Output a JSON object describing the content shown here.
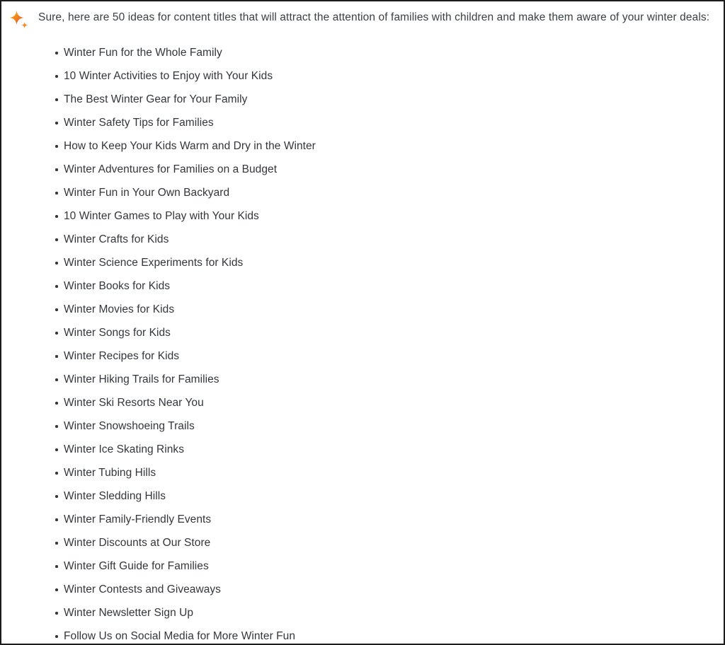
{
  "panel": {
    "border_color": "#1c1c1c",
    "background_color": "#ffffff",
    "text_color": "#33363b"
  },
  "icon": {
    "name": "sparkle-icon",
    "gradient_start": "#f9c22e",
    "gradient_mid": "#f07c1f",
    "gradient_end": "#e8452b"
  },
  "response": {
    "intro": "Sure, here are 50 ideas for content titles that will attract the attention of families with children and make them aware of your winter deals:",
    "items": [
      "Winter Fun for the Whole Family",
      "10 Winter Activities to Enjoy with Your Kids",
      "The Best Winter Gear for Your Family",
      "Winter Safety Tips for Families",
      "How to Keep Your Kids Warm and Dry in the Winter",
      "Winter Adventures for Families on a Budget",
      "Winter Fun in Your Own Backyard",
      "10 Winter Games to Play with Your Kids",
      "Winter Crafts for Kids",
      "Winter Science Experiments for Kids",
      "Winter Books for Kids",
      "Winter Movies for Kids",
      "Winter Songs for Kids",
      "Winter Recipes for Kids",
      "Winter Hiking Trails for Families",
      "Winter Ski Resorts Near You",
      "Winter Snowshoeing Trails",
      "Winter Ice Skating Rinks",
      "Winter Tubing Hills",
      "Winter Sledding Hills",
      "Winter Family-Friendly Events",
      "Winter Discounts at Our Store",
      "Winter Gift Guide for Families",
      "Winter Contests and Giveaways",
      "Winter Newsletter Sign Up",
      "Follow Us on Social Media for More Winter Fun"
    ]
  }
}
